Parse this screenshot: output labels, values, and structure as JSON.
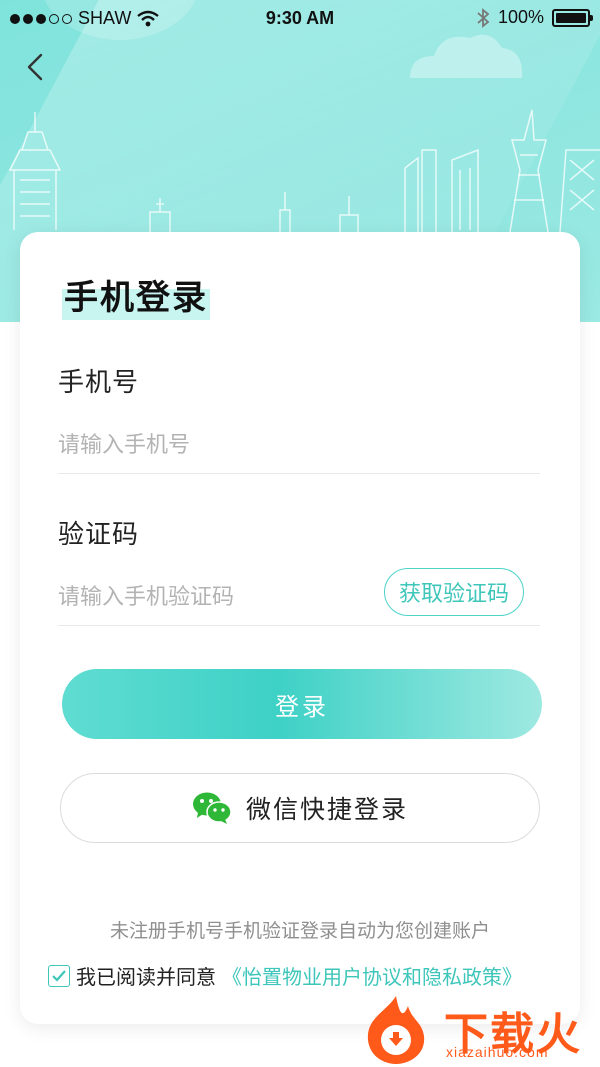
{
  "status_bar": {
    "carrier": "SHAW",
    "time": "9:30 AM",
    "battery": "100%"
  },
  "icons": {
    "back": "chevron-left-icon",
    "wifi": "wifi-icon",
    "bluetooth": "bluetooth-icon",
    "battery": "battery-icon",
    "wechat": "wechat-icon",
    "check": "check-icon"
  },
  "colors": {
    "accent": "#3fc6ba",
    "hero": "#8fe6e0",
    "watermark": "#ff5a1a"
  },
  "form": {
    "title": "手机登录",
    "phone_label": "手机号",
    "phone_placeholder": "请输入手机号",
    "phone_value": "",
    "code_label": "验证码",
    "code_placeholder": "请输入手机验证码",
    "code_value": "",
    "get_code_label": "获取验证码",
    "login_label": "登录",
    "wechat_label": "微信快捷登录"
  },
  "footer": {
    "hint": "未注册手机号手机验证登录自动为您创建账户",
    "agree_text": "我已阅读并同意",
    "agree_link": "《怡置物业用户协议和隐私政策》",
    "agreed": true
  },
  "watermark": {
    "brand": "下载火",
    "url": "xiazaihuo.com"
  }
}
